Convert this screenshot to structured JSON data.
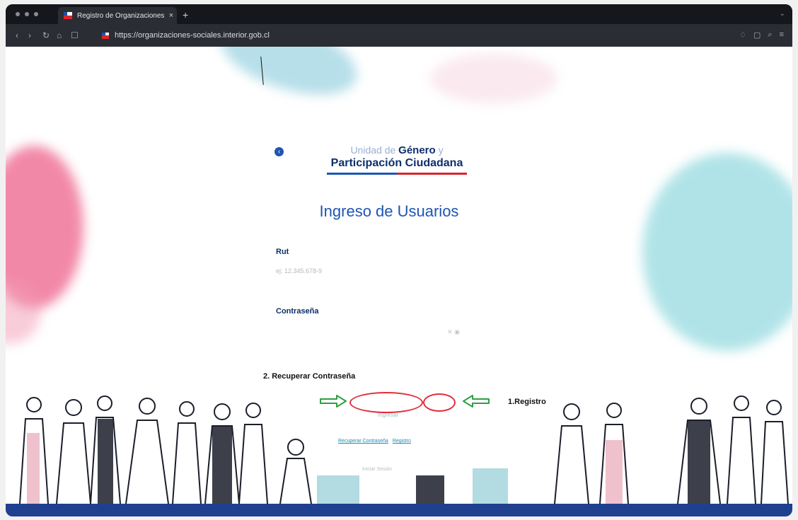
{
  "browser": {
    "tab_title": "Registro de Organizaciones",
    "tab_close": "×",
    "new_tab": "+",
    "url": "https://organizaciones-sociales.interior.gob.cl"
  },
  "logo": {
    "prefix": "Unidad de",
    "highlight": "Género",
    "suffix": "y",
    "line2": "Participación Ciudadana"
  },
  "login": {
    "title": "Ingreso de Usuarios",
    "rut_label": "Rut",
    "rut_placeholder": "ej: 12.345.678-9",
    "password_label": "Contraseña",
    "submit_label": "Ingresar",
    "recover_link": "Recuperar Contraseña",
    "register_link": "Registro",
    "bottom_text": "Iniciar Sesión"
  },
  "annotations": {
    "recover": "2. Recuperar Contraseña",
    "register": "1.Registro",
    "highlight_color": "#e32c3b",
    "arrow_color": "#2ea043"
  }
}
